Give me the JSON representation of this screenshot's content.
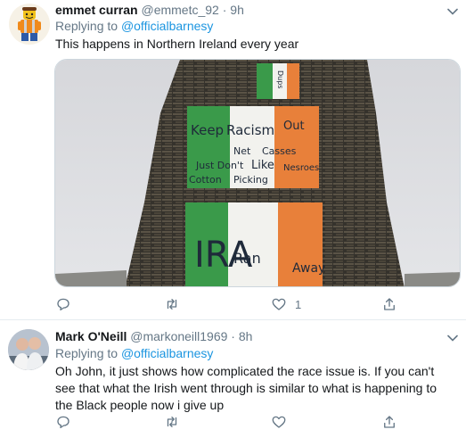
{
  "tweets": [
    {
      "name": "emmet curran",
      "handle": "@emmetc_92",
      "time": "· 9h",
      "replying_label": "Replying to",
      "replying_handle": "@officialbarnesy",
      "text": "This happens in Northern Ireland every year",
      "likes": "1",
      "flag_words": [
        "Keep",
        "Racism",
        "Out",
        "Net",
        "Casses",
        "Just Don't",
        "Like",
        "Nesroes",
        "Cotton",
        "Picking",
        "IRA",
        "Ran",
        "Away",
        "Dups"
      ]
    },
    {
      "name": "Mark O'Neill",
      "handle": "@markoneill1969",
      "time": "· 8h",
      "replying_label": "Replying to",
      "replying_handle": "@officialbarnesy",
      "text": "Oh John, it just shows how complicated the race issue is. If you can't see that what the Irish went through is similar to what is happening to the Black people now i give up"
    }
  ],
  "colors": {
    "accent": "#1b95e0",
    "muted": "#657786",
    "flag_green": "#3a9a4a",
    "flag_orange": "#e8803a"
  }
}
